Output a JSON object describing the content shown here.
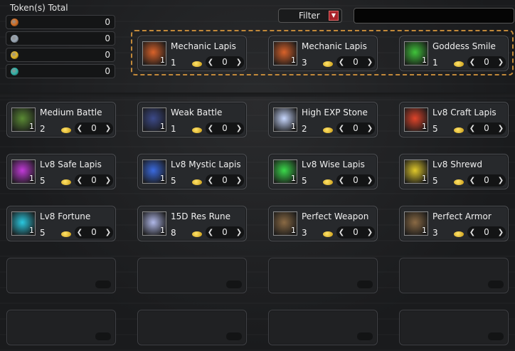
{
  "tokens": {
    "title": "Token(s) Total",
    "rows": [
      {
        "icon": "orange-token-icon",
        "color": "#d46a1c",
        "value": "0"
      },
      {
        "icon": "silver-token-icon",
        "color": "#9aa8b6",
        "value": "0"
      },
      {
        "icon": "gold-token-icon",
        "color": "#e5b520",
        "value": "0"
      },
      {
        "icon": "cyan-token-icon",
        "color": "#2bb3a8",
        "value": "0"
      }
    ]
  },
  "filter": {
    "label": "Filter",
    "arrow": "▼"
  },
  "search": {
    "value": ""
  },
  "featured": [
    {
      "name": "Mechanic Lapis",
      "qty": "1",
      "count": "0",
      "badge": "1",
      "icon": "mechanic-lapis-icon",
      "color": "#d9622a"
    },
    {
      "name": "Mechanic Lapis",
      "qty": "3",
      "count": "0",
      "badge": "1",
      "icon": "mechanic-lapis-icon",
      "color": "#d9622a"
    },
    {
      "name": "Goddess Smile",
      "qty": "1",
      "count": "0",
      "badge": "1",
      "icon": "goddess-smile-icon",
      "color": "#3fc43a"
    }
  ],
  "items": [
    {
      "name": "Medium Battle",
      "qty": "2",
      "count": "0",
      "badge": "1",
      "icon": "medium-battle-icon",
      "color": "#5a8a34"
    },
    {
      "name": "Weak Battle",
      "qty": "1",
      "count": "0",
      "badge": "1",
      "icon": "weak-battle-icon",
      "color": "#3c4a8a"
    },
    {
      "name": "High EXP Stone",
      "qty": "2",
      "count": "0",
      "badge": "1",
      "icon": "high-exp-stone-icon",
      "color": "#c8d8ff"
    },
    {
      "name": "Lv8 Craft Lapis",
      "qty": "5",
      "count": "0",
      "badge": "1",
      "icon": "craft-lapis-icon",
      "color": "#e0442a"
    },
    {
      "name": "Lv8 Safe Lapis",
      "qty": "5",
      "count": "0",
      "badge": "1",
      "icon": "safe-lapis-icon",
      "color": "#c23ad9"
    },
    {
      "name": "Lv8 Mystic Lapis",
      "qty": "5",
      "count": "0",
      "badge": "1",
      "icon": "mystic-lapis-icon",
      "color": "#3a6ae0"
    },
    {
      "name": "Lv8 Wise Lapis",
      "qty": "5",
      "count": "0",
      "badge": "1",
      "icon": "wise-lapis-icon",
      "color": "#3ad94a"
    },
    {
      "name": "Lv8 Shrewd",
      "qty": "5",
      "count": "0",
      "badge": "1",
      "icon": "shrewd-lapis-icon",
      "color": "#e0c82a"
    },
    {
      "name": "Lv8 Fortune",
      "qty": "5",
      "count": "0",
      "badge": "1",
      "icon": "fortune-lapis-icon",
      "color": "#2ac8e0"
    },
    {
      "name": "15D Res Rune",
      "qty": "8",
      "count": "0",
      "badge": "1",
      "icon": "res-rune-icon",
      "color": "#b0b8e8"
    },
    {
      "name": "Perfect Weapon",
      "qty": "3",
      "count": "0",
      "badge": "1",
      "icon": "perfect-weapon-icon",
      "color": "#8a6a44"
    },
    {
      "name": "Perfect Armor",
      "qty": "3",
      "count": "0",
      "badge": "1",
      "icon": "perfect-armor-icon",
      "color": "#8a6a44"
    }
  ],
  "empty_slots": 8
}
